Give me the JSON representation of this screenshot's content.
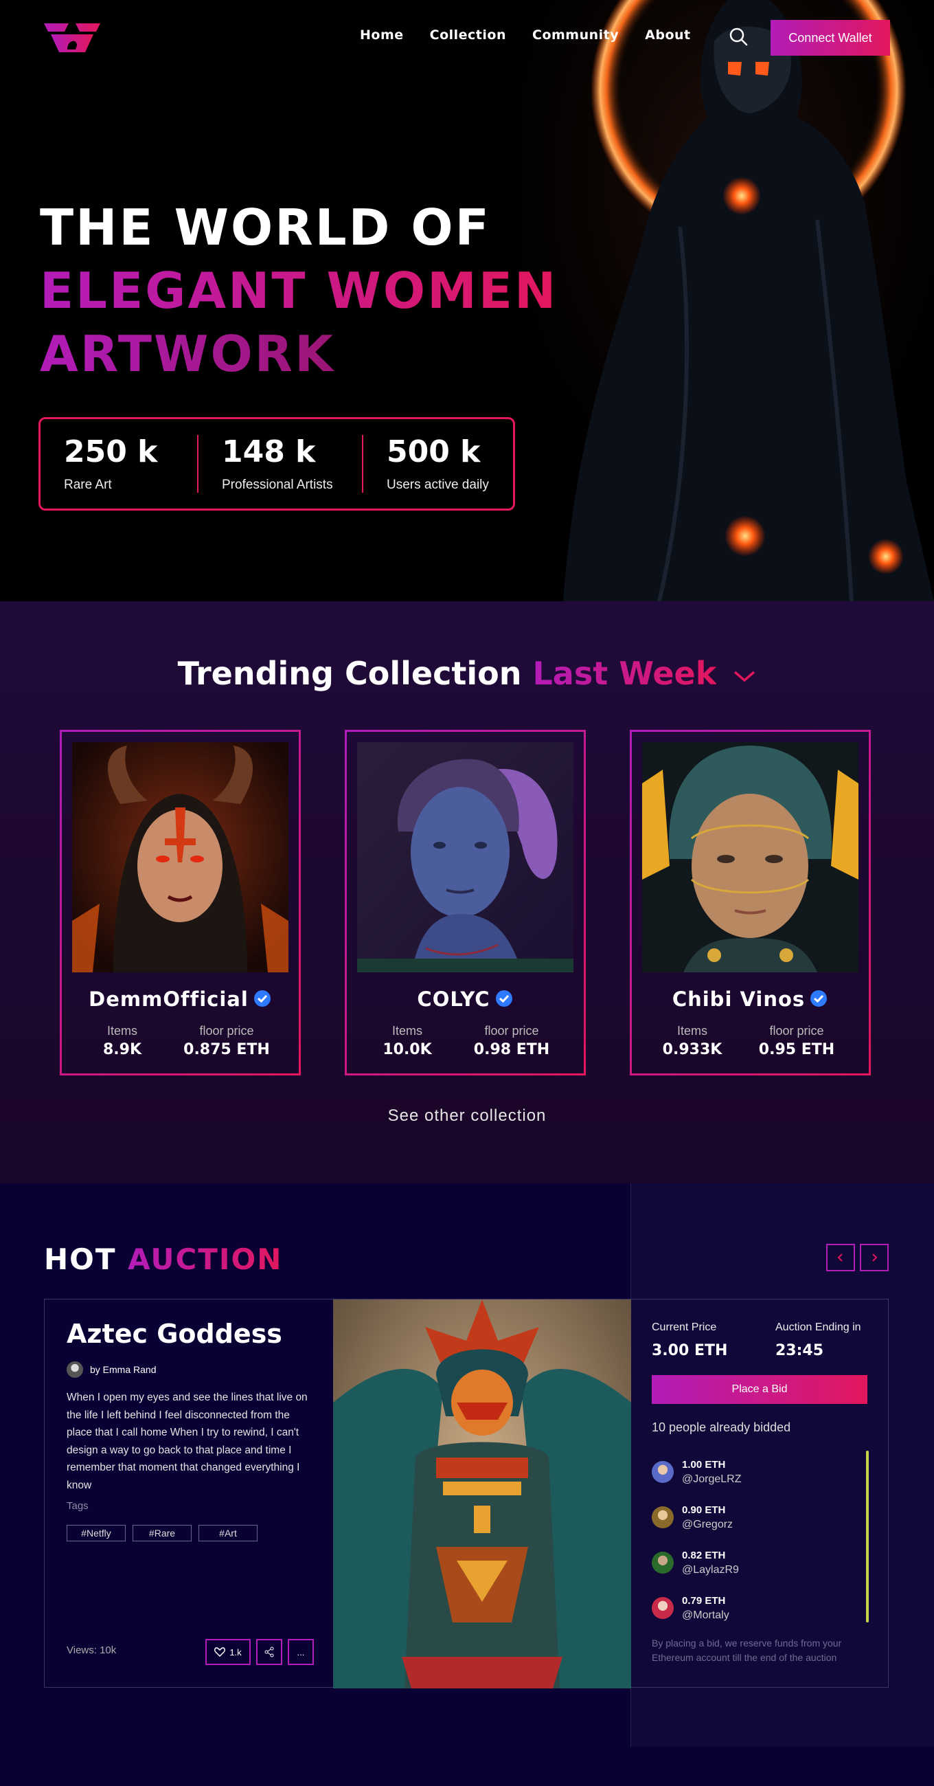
{
  "nav": {
    "links": [
      "Home",
      "Collection",
      "Community",
      "About"
    ],
    "wallet_label": "Connect Wallet"
  },
  "hero": {
    "line1": "THE WORLD OF",
    "line2": "ELEGANT WOMEN",
    "line3": "ARTWORK",
    "stats": [
      {
        "value": "250 k",
        "label": "Rare Art"
      },
      {
        "value": "148 k",
        "label": "Professional Artists"
      },
      {
        "value": "500 k",
        "label": "Users active daily"
      }
    ]
  },
  "trending": {
    "title_a": "Trending Collection",
    "title_b": "Last Week",
    "cards": [
      {
        "name": "DemmOfficial",
        "items_label": "Items",
        "items": "8.9K",
        "floor_label": "floor price",
        "floor": "0.875 ETH"
      },
      {
        "name": "COLYC",
        "items_label": "Items",
        "items": "10.0K",
        "floor_label": "floor price",
        "floor": "0.98 ETH"
      },
      {
        "name": "Chibi Vinos",
        "items_label": "Items",
        "items": "0.933K",
        "floor_label": "floor price",
        "floor": "0.95 ETH"
      }
    ],
    "see_other": "See other collection"
  },
  "auction": {
    "title_a": "HOT",
    "title_b": "AUCTION",
    "name": "Aztec Goddess",
    "author": "by Emma Rand",
    "description": "When I open my eyes and see the lines that live on the life I left behind  I feel disconnected from the place that I call home When I try to rewind, I can't design a way to go back to that place and time I remember that moment that changed everything I know",
    "tags_label": "Tags",
    "tags": [
      "#Netfly",
      "#Rare",
      "#Art"
    ],
    "views": "Views: 10k",
    "likes": "1.k",
    "more": "...",
    "current_price_label": "Current Price",
    "current_price": "3.00 ETH",
    "ending_label": "Auction Ending in",
    "ending": "23:45",
    "bid_button": "Place a Bid",
    "bidded": "10 people already bidded",
    "bids": [
      {
        "eth": "1.00 ETH",
        "user": "@JorgeLRZ"
      },
      {
        "eth": "0.90 ETH",
        "user": "@Gregorz"
      },
      {
        "eth": "0.82 ETH",
        "user": "@LaylazR9"
      },
      {
        "eth": "0.79 ETH",
        "user": "@Mortaly"
      }
    ],
    "disclaimer": "By placing a bid, we reserve  funds from your Ethereum account till the end of the auction"
  },
  "colors": {
    "accent_start": "#b21cb8",
    "accent_end": "#e2175d",
    "verified": "#2f7bff"
  }
}
